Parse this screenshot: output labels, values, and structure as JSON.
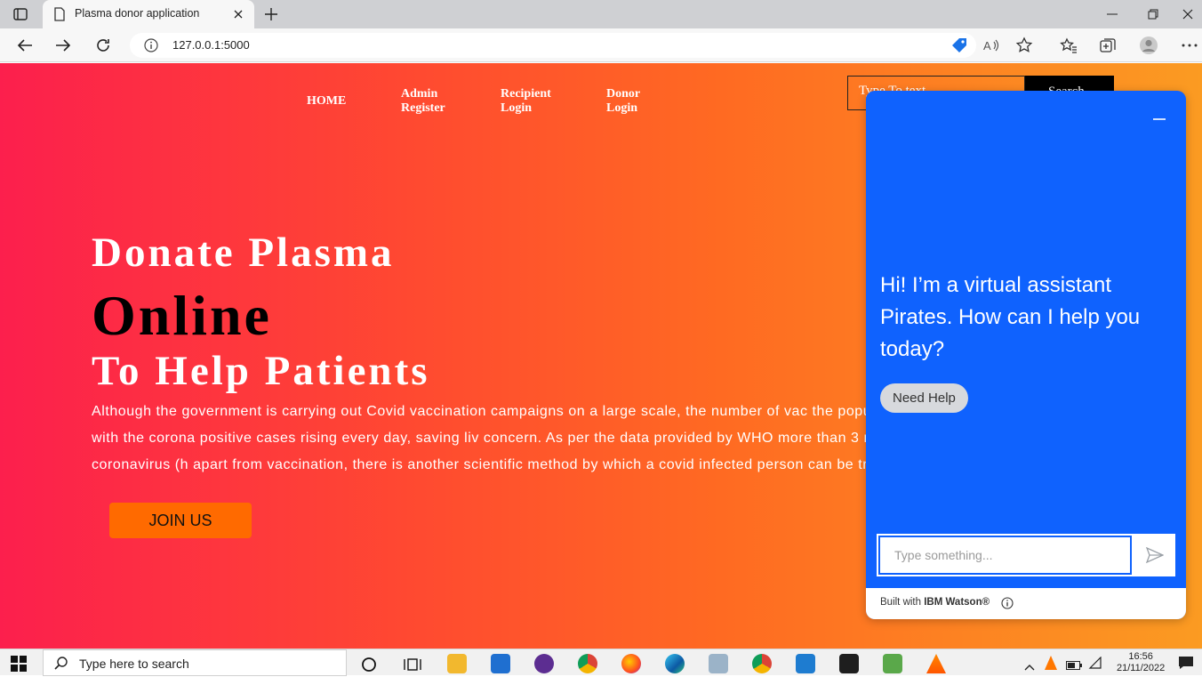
{
  "browser": {
    "tab_title": "Plasma donor application",
    "url": "127.0.0.1:5000"
  },
  "nav": {
    "home": "HOME",
    "admin_register": "Admin\nRegister",
    "recipient_login": "Recipient\nLogin",
    "donor_login": "Donor\nLogin",
    "search_placeholder": "Type To text",
    "search_button": "Search"
  },
  "hero": {
    "line1": "Donate Plasma",
    "line2": "Online",
    "line3": "To Help Patients",
    "paragraph": "Although the government is carrying out Covid vaccination campaigns on a large scale, the number of vac the population to get vaccinated at present. And with the corona positive cases rising every day, saving liv concern. As per the data provided by WHO more than 3 million people have died due to the coronavirus (h apart from vaccination, there is another scientific method by which a covid infected person can be treated",
    "join_button": "JOIN US"
  },
  "chat": {
    "greeting": "Hi! I’m a virtual assistant Pirates. How can I help you today?",
    "chip": "Need Help",
    "input_placeholder": "Type something...",
    "footer_prefix": "Built with ",
    "footer_brand": "IBM Watson®"
  },
  "taskbar": {
    "search_placeholder": "Type here to search",
    "time": "16:56",
    "date": "21/11/2022"
  },
  "colors": {
    "accent_blue": "#0f62fe",
    "join_orange": "#ff6a00",
    "gradient_start": "#fc1f4d",
    "gradient_end": "#fb9b22"
  }
}
